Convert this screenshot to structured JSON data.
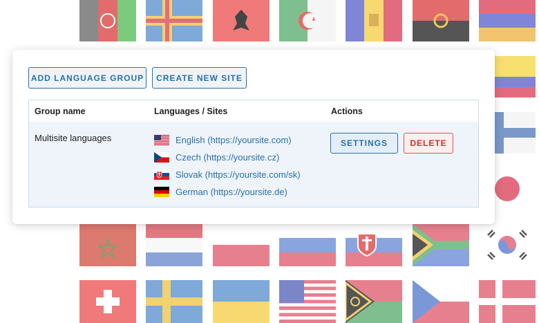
{
  "toolbar": {
    "add_group_label": "ADD LANGUAGE GROUP",
    "create_site_label": "CREATE NEW SITE"
  },
  "table": {
    "headers": [
      "Group name",
      "Languages / Sites",
      "Actions"
    ],
    "rows": [
      {
        "group_name": "Multisite languages",
        "languages": [
          {
            "flag": "us-flag-icon",
            "label": "English (https://yoursite.com)"
          },
          {
            "flag": "cz-flag-icon",
            "label": "Czech (https://yoursite.cz)"
          },
          {
            "flag": "sk-flag-icon",
            "label": "Slovak (https://yoursite.com/sk)"
          },
          {
            "flag": "de-flag-icon",
            "label": "German (https://yoursite.de)"
          }
        ],
        "settings_label": "SETTINGS",
        "delete_label": "DELETE"
      }
    ]
  },
  "colors": {
    "accent": "#2a6fa6",
    "danger": "#c9302c",
    "row_background": "#eef4fa"
  }
}
